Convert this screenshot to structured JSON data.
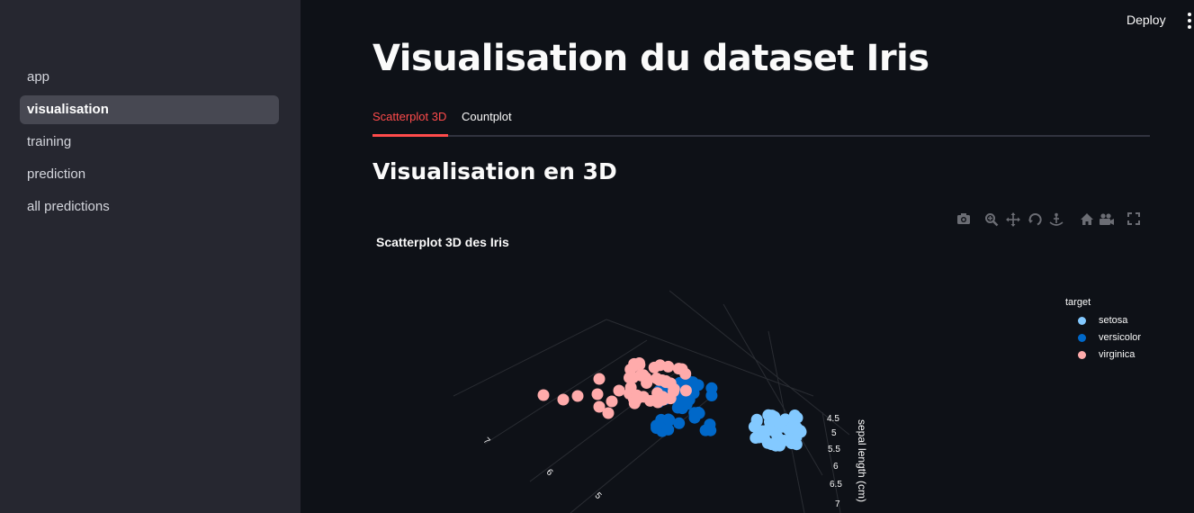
{
  "sidebar": {
    "items": [
      {
        "label": "app",
        "active": false
      },
      {
        "label": "visualisation",
        "active": true
      },
      {
        "label": "training",
        "active": false
      },
      {
        "label": "prediction",
        "active": false
      },
      {
        "label": "all predictions",
        "active": false
      }
    ]
  },
  "header": {
    "deploy_label": "Deploy",
    "menu_icon": "vertical-dots-icon"
  },
  "main": {
    "title": "Visualisation du dataset Iris",
    "tabs": [
      {
        "label": "Scatterplot 3D",
        "active": true
      },
      {
        "label": "Countplot",
        "active": false
      }
    ],
    "section_title": "Visualisation en 3D"
  },
  "modebar": {
    "icons": [
      "camera-icon",
      "zoom-icon",
      "pan-icon",
      "orbit-rotation-icon",
      "turntable-rotation-icon",
      "home-icon",
      "camera-view-icon",
      "fullscreen-icon"
    ]
  },
  "colors": {
    "accent": "#ff4b4b",
    "setosa": "#83c9ff",
    "versicolor": "#0068c9",
    "virginica": "#ffabab"
  },
  "chart_data": {
    "type": "scatter",
    "title": "Scatterplot 3D des Iris",
    "legend_title": "target",
    "legend_position": "top-right",
    "axes": {
      "sepal_length": {
        "label": "sepal length (cm)",
        "ticks": [
          "4.5",
          "5",
          "5.5",
          "6",
          "6.5",
          "7"
        ]
      },
      "other_axis": {
        "ticks": [
          "7",
          "6",
          "5"
        ]
      }
    },
    "series": [
      {
        "name": "setosa",
        "color": "#83c9ff"
      },
      {
        "name": "versicolor",
        "color": "#0068c9"
      },
      {
        "name": "virginica",
        "color": "#ffabab"
      }
    ]
  }
}
